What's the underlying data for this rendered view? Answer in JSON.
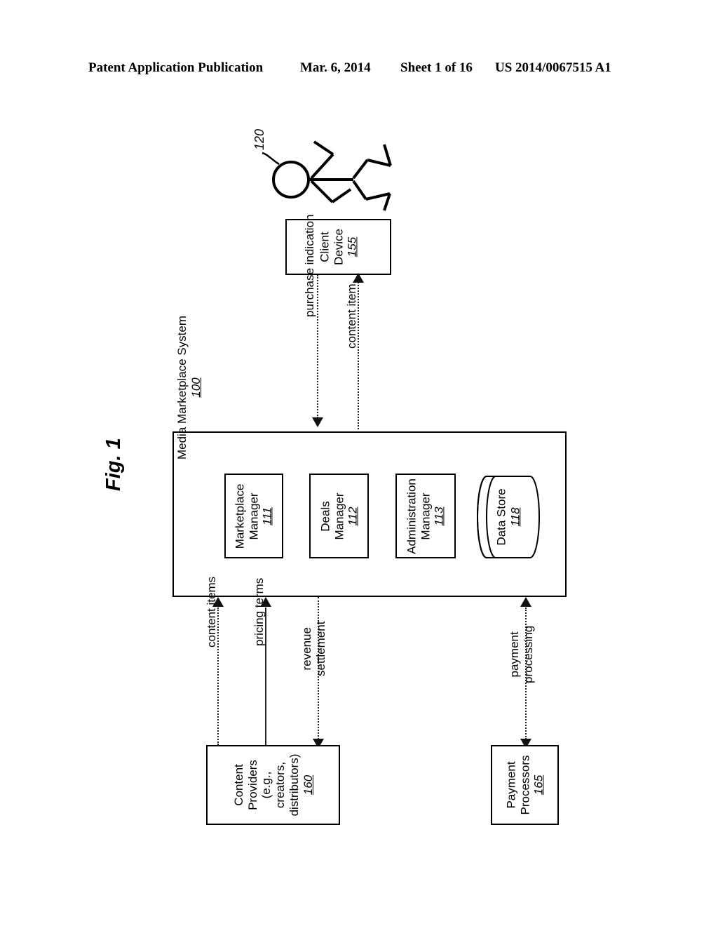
{
  "header": {
    "publication": "Patent Application Publication",
    "date": "Mar. 6, 2014",
    "sheet": "Sheet 1 of 16",
    "patent_number": "US 2014/0067515 A1"
  },
  "figure": {
    "label": "Fig. 1",
    "user_ref": "120"
  },
  "client_device": {
    "line1": "Client",
    "line2": "Device",
    "ref": "155"
  },
  "system": {
    "title_line1": "Media Marketplace System",
    "ref": "100",
    "components": [
      {
        "line1": "Marketplace",
        "line2": "Manager",
        "ref": "111"
      },
      {
        "line1": "Deals",
        "line2": "Manager",
        "ref": "112"
      },
      {
        "line1": "Administration",
        "line2": "Manager",
        "ref": "113"
      }
    ],
    "data_store": {
      "line1": "Data Store",
      "ref": "118"
    }
  },
  "content_providers": {
    "line1": "Content",
    "line2": "Providers",
    "line3": "(e.g.,",
    "line4": "creators,",
    "line5": "distributors)",
    "ref": "160"
  },
  "payment_processors": {
    "line1": "Payment",
    "line2": "Processors",
    "ref": "165"
  },
  "connectors": {
    "purchase_indication": "purchase indication",
    "content_item": "content item",
    "content_items": "content items",
    "pricing_terms": "pricing terms",
    "revenue_line1": "revenue",
    "revenue_line2": "settlement",
    "payment_line1": "payment",
    "payment_line2": "processing"
  },
  "colors": {
    "ink": "#000000",
    "background": "#ffffff"
  }
}
